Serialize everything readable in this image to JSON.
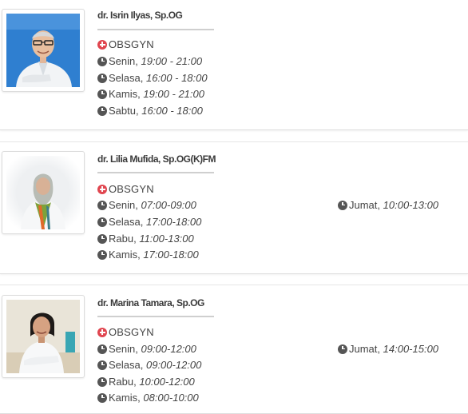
{
  "doctors": [
    {
      "name": "dr. Isrin Ilyas, Sp.OG",
      "specialty": "OBSGYN",
      "schedule": [
        {
          "day": "Senin",
          "time": "19:00 - 21:00"
        },
        {
          "day": "Selasa",
          "time": "16:00 - 18:00"
        },
        {
          "day": "Kamis",
          "time": "19:00 - 21:00"
        },
        {
          "day": "Sabtu",
          "time": "16:00 - 18:00"
        }
      ],
      "schedule_right": []
    },
    {
      "name": "dr. Lilia Mufida, Sp.OG(K)FM",
      "specialty": "OBSGYN",
      "schedule": [
        {
          "day": "Senin",
          "time": "07:00-09:00"
        },
        {
          "day": "Selasa",
          "time": "17:00-18:00"
        },
        {
          "day": "Rabu",
          "time": "11:00-13:00"
        },
        {
          "day": "Kamis",
          "time": "17:00-18:00"
        }
      ],
      "schedule_right": [
        {
          "day": "Jumat",
          "time": "10:00-13:00"
        }
      ]
    },
    {
      "name": "dr. Marina Tamara, Sp.OG",
      "specialty": "OBSGYN",
      "schedule": [
        {
          "day": "Senin",
          "time": "09:00-12:00"
        },
        {
          "day": "Selasa",
          "time": "09:00-12:00"
        },
        {
          "day": "Rabu",
          "time": "10:00-12:00"
        },
        {
          "day": "Kamis",
          "time": "08:00-10:00"
        }
      ],
      "schedule_right": [
        {
          "day": "Jumat",
          "time": "14:00-15:00"
        }
      ]
    }
  ],
  "colors": {
    "specialty_icon": "#e0454f",
    "clock_icon": "#555555",
    "photo_bg_blue": "#2f7fd0"
  },
  "icons": {
    "specialty": "medical-cross-icon",
    "schedule": "clock-icon"
  }
}
